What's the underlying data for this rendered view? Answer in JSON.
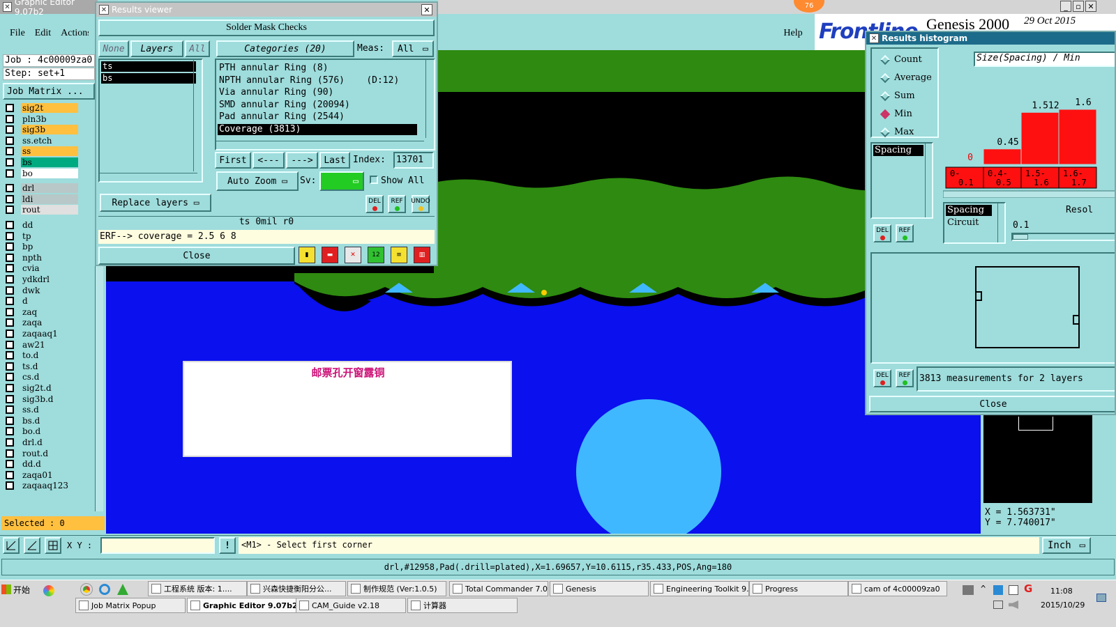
{
  "graphic_editor": {
    "title": "Graphic Editor 9.07b2",
    "menu": [
      "File",
      "Edit",
      "Actions"
    ],
    "job": "Job : 4c00009za0",
    "step": "Step: set+1",
    "job_matrix_label": "Job Matrix ...",
    "help_label": "Help",
    "badge": "76",
    "brand": "Frontline",
    "product": "Genesis 2000",
    "date": "29 Oct 2015",
    "layers": [
      {
        "name": "sig2t",
        "color": "#ffc040"
      },
      {
        "name": "pln3b",
        "color": "#9fdcdc"
      },
      {
        "name": "sig3b",
        "color": "#ffc040"
      },
      {
        "name": "ss.etch",
        "color": "#9fdcdc"
      },
      {
        "name": "ss",
        "color": "#ffc040"
      },
      {
        "name": "bs",
        "color": "#00aa80"
      },
      {
        "name": "bo",
        "color": "#ffffff"
      },
      {
        "name": "drl",
        "color": "#b8c8c8"
      },
      {
        "name": "ldi",
        "color": "#b8c8c8"
      },
      {
        "name": "rout",
        "color": "#e0e0e0"
      },
      {
        "name": "dd",
        "color": "#9fdcdc"
      },
      {
        "name": "tp",
        "color": "#9fdcdc"
      },
      {
        "name": "bp",
        "color": "#9fdcdc"
      },
      {
        "name": "npth",
        "color": "#9fdcdc"
      },
      {
        "name": "cvia",
        "color": "#9fdcdc"
      },
      {
        "name": "ydkdrl",
        "color": "#9fdcdc"
      },
      {
        "name": "dwk",
        "color": "#9fdcdc"
      },
      {
        "name": "d",
        "color": "#9fdcdc"
      },
      {
        "name": "zaq",
        "color": "#9fdcdc"
      },
      {
        "name": "zaqa",
        "color": "#9fdcdc"
      },
      {
        "name": "zaqaaq1",
        "color": "#9fdcdc"
      },
      {
        "name": "aw21",
        "color": "#9fdcdc"
      },
      {
        "name": "to.d",
        "color": "#9fdcdc"
      },
      {
        "name": "ts.d",
        "color": "#9fdcdc"
      },
      {
        "name": "cs.d",
        "color": "#9fdcdc"
      },
      {
        "name": "sig2t.d",
        "color": "#9fdcdc"
      },
      {
        "name": "sig3b.d",
        "color": "#9fdcdc"
      },
      {
        "name": "ss.d",
        "color": "#9fdcdc"
      },
      {
        "name": "bs.d",
        "color": "#9fdcdc"
      },
      {
        "name": "bo.d",
        "color": "#9fdcdc"
      },
      {
        "name": "drl.d",
        "color": "#9fdcdc"
      },
      {
        "name": "rout.d",
        "color": "#9fdcdc"
      },
      {
        "name": "dd.d",
        "color": "#9fdcdc"
      },
      {
        "name": "zaqa01",
        "color": "#9fdcdc"
      },
      {
        "name": "zaqaaq123",
        "color": "#9fdcdc"
      }
    ],
    "selected": "Selected : 0",
    "xy_label": "X Y :",
    "prompt": "<M1> - Select first corner",
    "units": "Inch",
    "status": "drl,#12958,Pad(.drill=plated),X=1.69657,Y=10.6115,r35.433,POS,Ang=180",
    "coord_x": "X = 1.563731\"",
    "coord_y": "Y = 7.740017\"",
    "annotation": "邮票孔开窗露铜"
  },
  "results_viewer": {
    "title": "Results viewer",
    "header": "Solder Mask Checks",
    "none_btn": "None",
    "layers_btn": "Layers",
    "all_btn": "All",
    "categories_btn": "Categories (20)",
    "meas_label": "Meas:",
    "meas_value": "All",
    "layer_list": [
      "ts",
      "bs"
    ],
    "categories": [
      "PTH annular Ring (8)",
      "NPTH annular Ring (576)    (D:12)",
      "Via annular Ring (90)",
      "SMD annular Ring (20094)",
      "Pad annular Ring (2544)",
      "Coverage (3813)"
    ],
    "first": "First",
    "prev": "<---",
    "next": "--->",
    "last": "Last",
    "index_label": "Index:",
    "index_value": "13701",
    "auto_zoom": "Auto Zoom",
    "sv_label": "Sv:",
    "show_all": "Show All",
    "replace_layers": "Replace layers",
    "del": "DEL",
    "ref": "REF",
    "undo": "UNDO",
    "info": "ts 0mil  r0",
    "erf": "ERF--> coverage = 2.5 6 8",
    "close": "Close"
  },
  "histogram": {
    "title": "Results histogram",
    "modes": [
      {
        "label": "Count",
        "on": false
      },
      {
        "label": "Average",
        "on": false
      },
      {
        "label": "Sum",
        "on": false
      },
      {
        "label": "Min",
        "on": true
      },
      {
        "label": "Max",
        "on": false
      }
    ],
    "spacing_list": [
      "Spacing"
    ],
    "header": "Size(Spacing) / Min",
    "value_labels": [
      "0",
      "0.45",
      "1.512",
      "1.6"
    ],
    "bins": [
      "0-\n0.1",
      "0.4-\n0.5",
      "1.5-\n1.6",
      "1.6-\n1.7"
    ],
    "type_list": [
      "Spacing",
      "Circuit"
    ],
    "resol_label": "Resol",
    "resol_value": "0.1",
    "measurements": "3813 measurements for 2 layers",
    "close": "Close",
    "del": "DEL",
    "ref": "REF"
  },
  "taskbar": {
    "start": "开始",
    "row1": [
      {
        "label": "工程系统  版本: 1...."
      },
      {
        "label": "兴森快捷衡阳分公..."
      },
      {
        "label": "制作规范 (Ver:1.0.5)"
      },
      {
        "label": "Total Commander 7.0..."
      },
      {
        "label": "Genesis"
      },
      {
        "label": "Engineering Toolkit 9...."
      },
      {
        "label": "Progress"
      },
      {
        "label": "cam of 4c00009za0"
      }
    ],
    "row2": [
      {
        "label": "Job Matrix Popup"
      },
      {
        "label": "Graphic Editor 9.07b2 ..."
      },
      {
        "label": "CAM_Guide v2.18"
      },
      {
        "label": "计算器"
      }
    ],
    "time": "11:08",
    "date": "2015/10/29"
  }
}
